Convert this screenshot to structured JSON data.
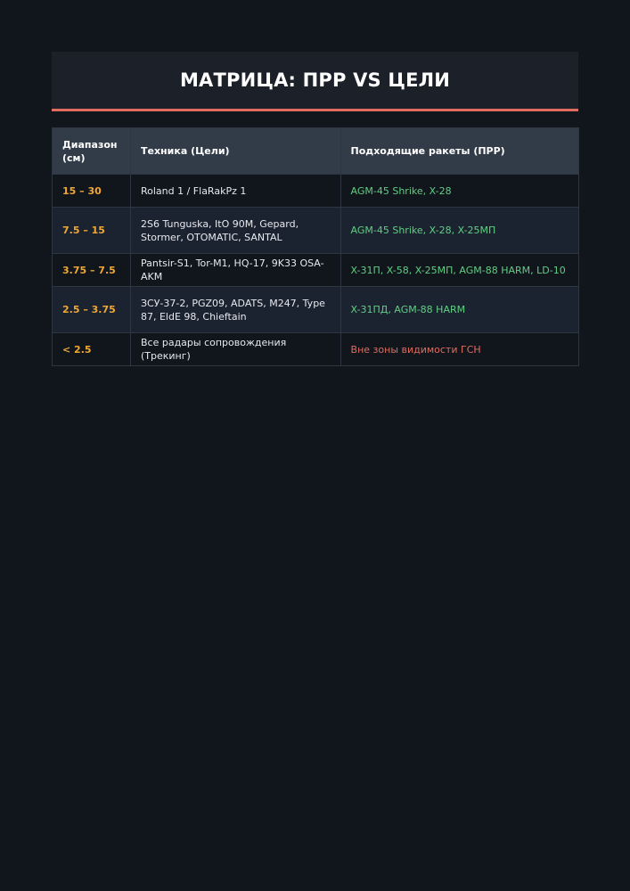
{
  "header": {
    "title": "МАТРИЦА: ПРР VS ЦЕЛИ"
  },
  "table": {
    "columns": [
      "Диапазон (см)",
      "Техника (Цели)",
      "Подходящие ракеты (ПРР)"
    ],
    "rows": [
      {
        "range": "15 – 30",
        "targets": "Roland 1 / FlaRakPz 1",
        "missiles": "AGM-45 Shrike, X-28"
      },
      {
        "range": "7.5 – 15",
        "targets": "2S6 Tunguska, ItO 90M, Gepard, Stormer, OTOMATIC, SANTAL",
        "missiles": "AGM-45 Shrike, X-28, X-25МП"
      },
      {
        "range": "3.75 – 7.5",
        "targets": "Pantsir-S1, Tor-M1, HQ-17, 9K33 OSA-AKM",
        "missiles": "X-31П, X-58, X-25МП, AGM-88 HARM, LD-10"
      },
      {
        "range": "2.5 – 3.75",
        "targets": "ЗСУ-37-2, PGZ09, ADATS, M247, Type 87, EldE 98, Chieftain",
        "missiles": "X-31ПД, AGM-88 HARM"
      },
      {
        "range": "< 2.5",
        "targets": "Все радары сопровождения (Трекинг)",
        "missiles": "Вне зоны видимости ГСН"
      }
    ]
  },
  "colors": {
    "background": "#11151c",
    "accent_line": "#e06c5f",
    "range_text": "#f0a833",
    "missile_text": "#5fcf83",
    "out_of_range_text": "#e06c5f"
  }
}
